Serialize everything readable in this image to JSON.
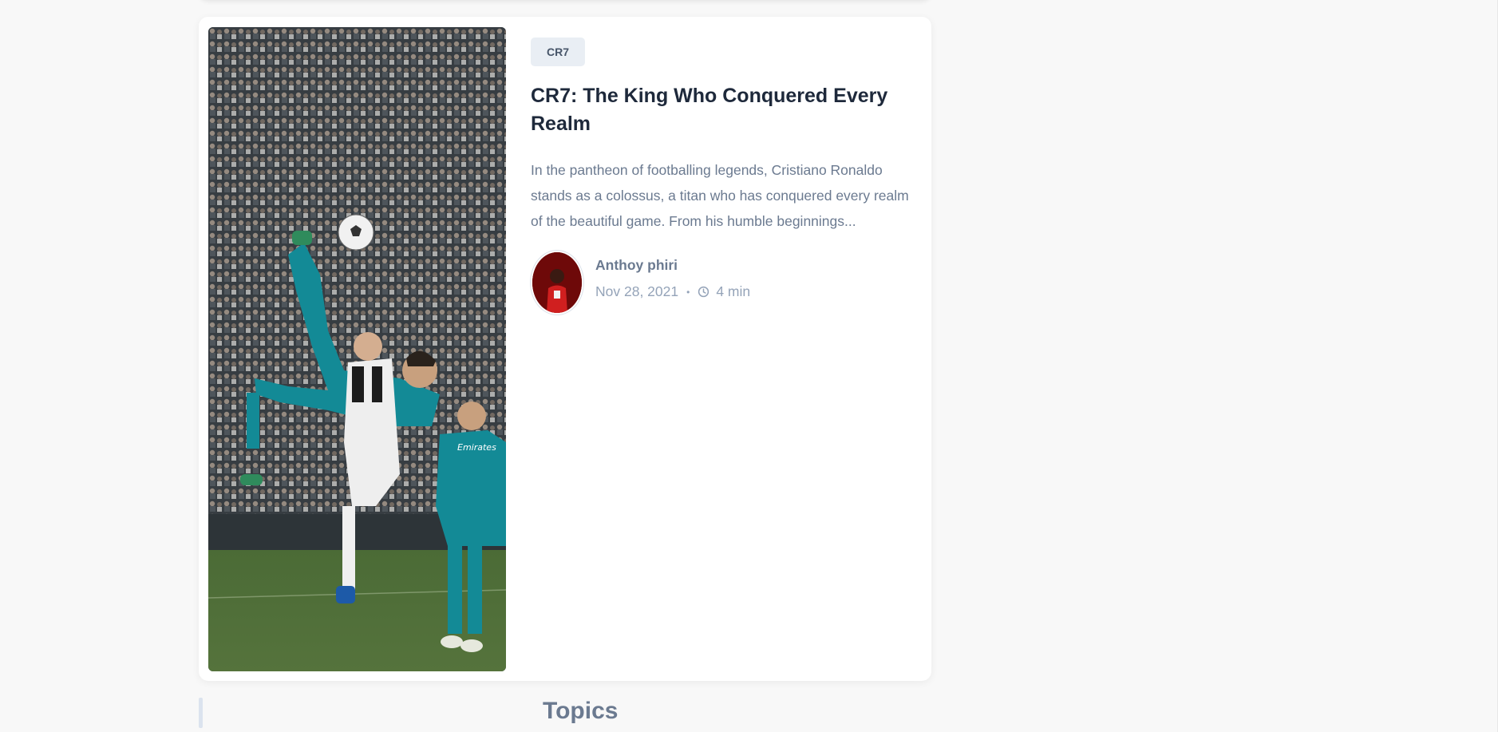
{
  "post": {
    "tag": "CR7",
    "title": "CR7: The King Who Conquered Every Realm",
    "excerpt": "In the pantheon of footballing legends, Cristiano Ronaldo stands as a colossus, a titan who has conquered every realm of the beautiful game. From his humble beginnings...",
    "author": "Anthoy phiri",
    "date": "Nov 28, 2021",
    "separator": "•",
    "read_time": "4 min"
  },
  "section": {
    "title": "Topics"
  },
  "icons": {
    "read_time": "clock-icon"
  },
  "colors": {
    "title": "#1e293b",
    "muted_text": "#6b7a90",
    "meta_text": "#94a3b8",
    "tag_bg": "#e9eef4",
    "card_bg": "#ffffff",
    "page_bg": "#f8f8f8"
  }
}
